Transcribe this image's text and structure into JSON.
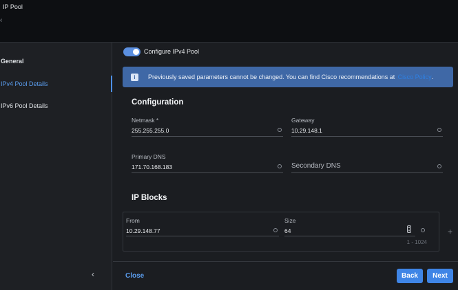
{
  "header": {
    "title": "IP Pool",
    "back_glyph": "‹"
  },
  "sidebar": {
    "items": [
      {
        "label": "General"
      },
      {
        "label": "IPv4 Pool Details"
      },
      {
        "label": "IPv6 Pool Details"
      }
    ],
    "active_index": 1,
    "collapse_glyph": "‹"
  },
  "toggle": {
    "label": "Configure IPv4 Pool",
    "on": true
  },
  "banner": {
    "message": "Previously saved parameters cannot be changed. You can find Cisco recommendations at",
    "link": "Cisco Policy",
    "trailing": "."
  },
  "configuration": {
    "title": "Configuration",
    "netmask": {
      "label": "Netmask *",
      "value": "255.255.255.0"
    },
    "gateway": {
      "label": "Gateway",
      "value": "10.29.148.1"
    },
    "primary_dns": {
      "label": "Primary DNS",
      "value": "171.70.168.183"
    },
    "secondary_dns": {
      "placeholder": "Secondary DNS"
    }
  },
  "ip_blocks": {
    "title": "IP Blocks",
    "from": {
      "label": "From",
      "value": "10.29.148.77"
    },
    "size": {
      "label": "Size",
      "value": "64",
      "range": "1 - 1024"
    },
    "add_glyph": "+"
  },
  "footer": {
    "close_label": "Close",
    "back_label": "Back",
    "next_label": "Next"
  },
  "colors": {
    "accent": "#3f85e6",
    "banner": "#3f68a6",
    "background": "#1b1d21"
  }
}
